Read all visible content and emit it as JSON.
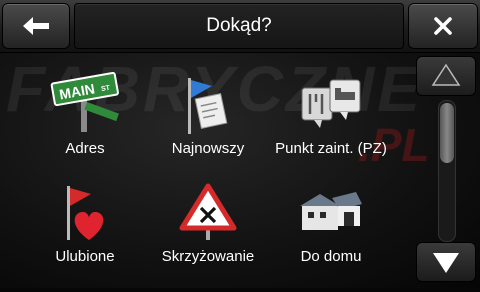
{
  "header": {
    "title": "Dokąd?",
    "back_icon": "arrow-left-icon",
    "close_icon": "close-icon"
  },
  "watermark": {
    "line1": "FABRYCZNE",
    "line2": ".PL"
  },
  "menu": {
    "items": [
      {
        "label": "Adres",
        "icon": "street-sign-icon",
        "sign_text": "MAIN",
        "sign_suffix": "ST"
      },
      {
        "label": "Najnowszy",
        "icon": "recent-flag-icon"
      },
      {
        "label": "Punkt zaint. (PZ)",
        "icon": "poi-icon"
      },
      {
        "label": "Ulubione",
        "icon": "favorites-heart-icon"
      },
      {
        "label": "Skrzyżowanie",
        "icon": "intersection-sign-icon"
      },
      {
        "label": "Do domu",
        "icon": "home-icon"
      }
    ]
  },
  "scroll": {
    "up_icon": "scroll-up-icon",
    "down_icon": "scroll-down-icon"
  }
}
